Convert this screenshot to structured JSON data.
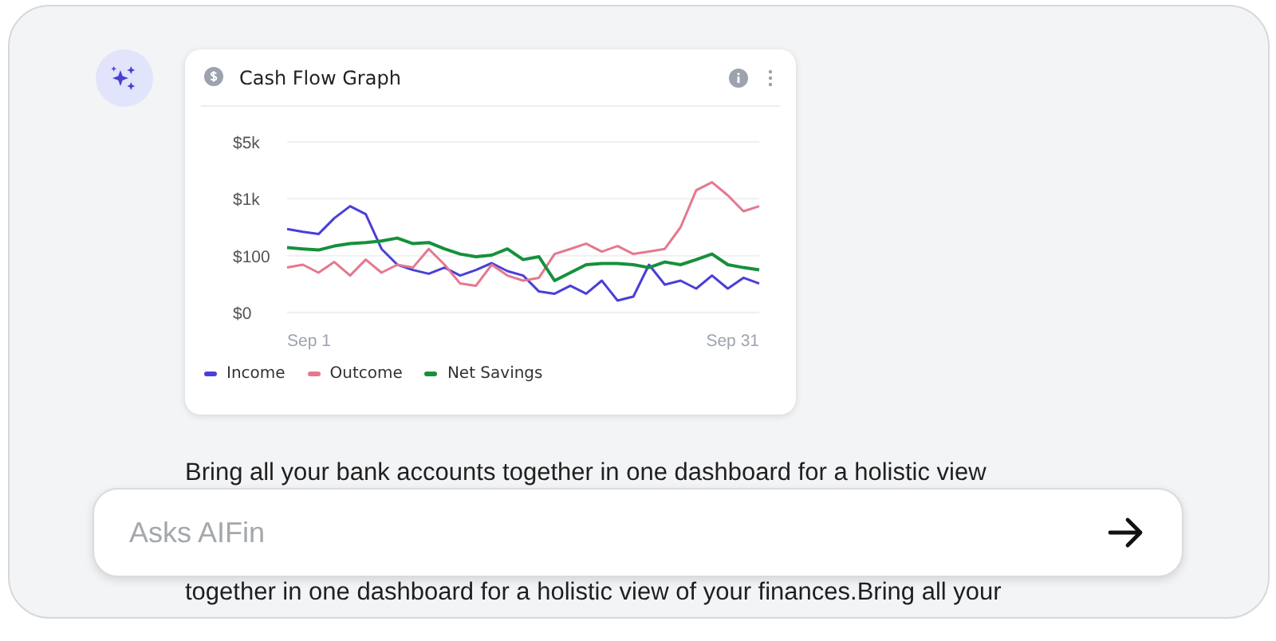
{
  "card": {
    "title": "Cash Flow Graph",
    "chart": {
      "y_labels": [
        "$5k",
        "$1k",
        "$100",
        "$0"
      ],
      "x_labels": [
        "Sep 1",
        "Sep 31"
      ],
      "legend": [
        {
          "name": "Income",
          "color": "#4a3fd8"
        },
        {
          "name": "Outcome",
          "color": "#e5788e"
        },
        {
          "name": "Net Savings",
          "color": "#16903c"
        }
      ]
    }
  },
  "message": {
    "lines": [
      "Bring all your bank accounts together in one dashboard for a holistic view",
      "together in one dashboard for a holistic view of your finances.Bring all your"
    ]
  },
  "input": {
    "placeholder": "Asks AIFin"
  }
}
